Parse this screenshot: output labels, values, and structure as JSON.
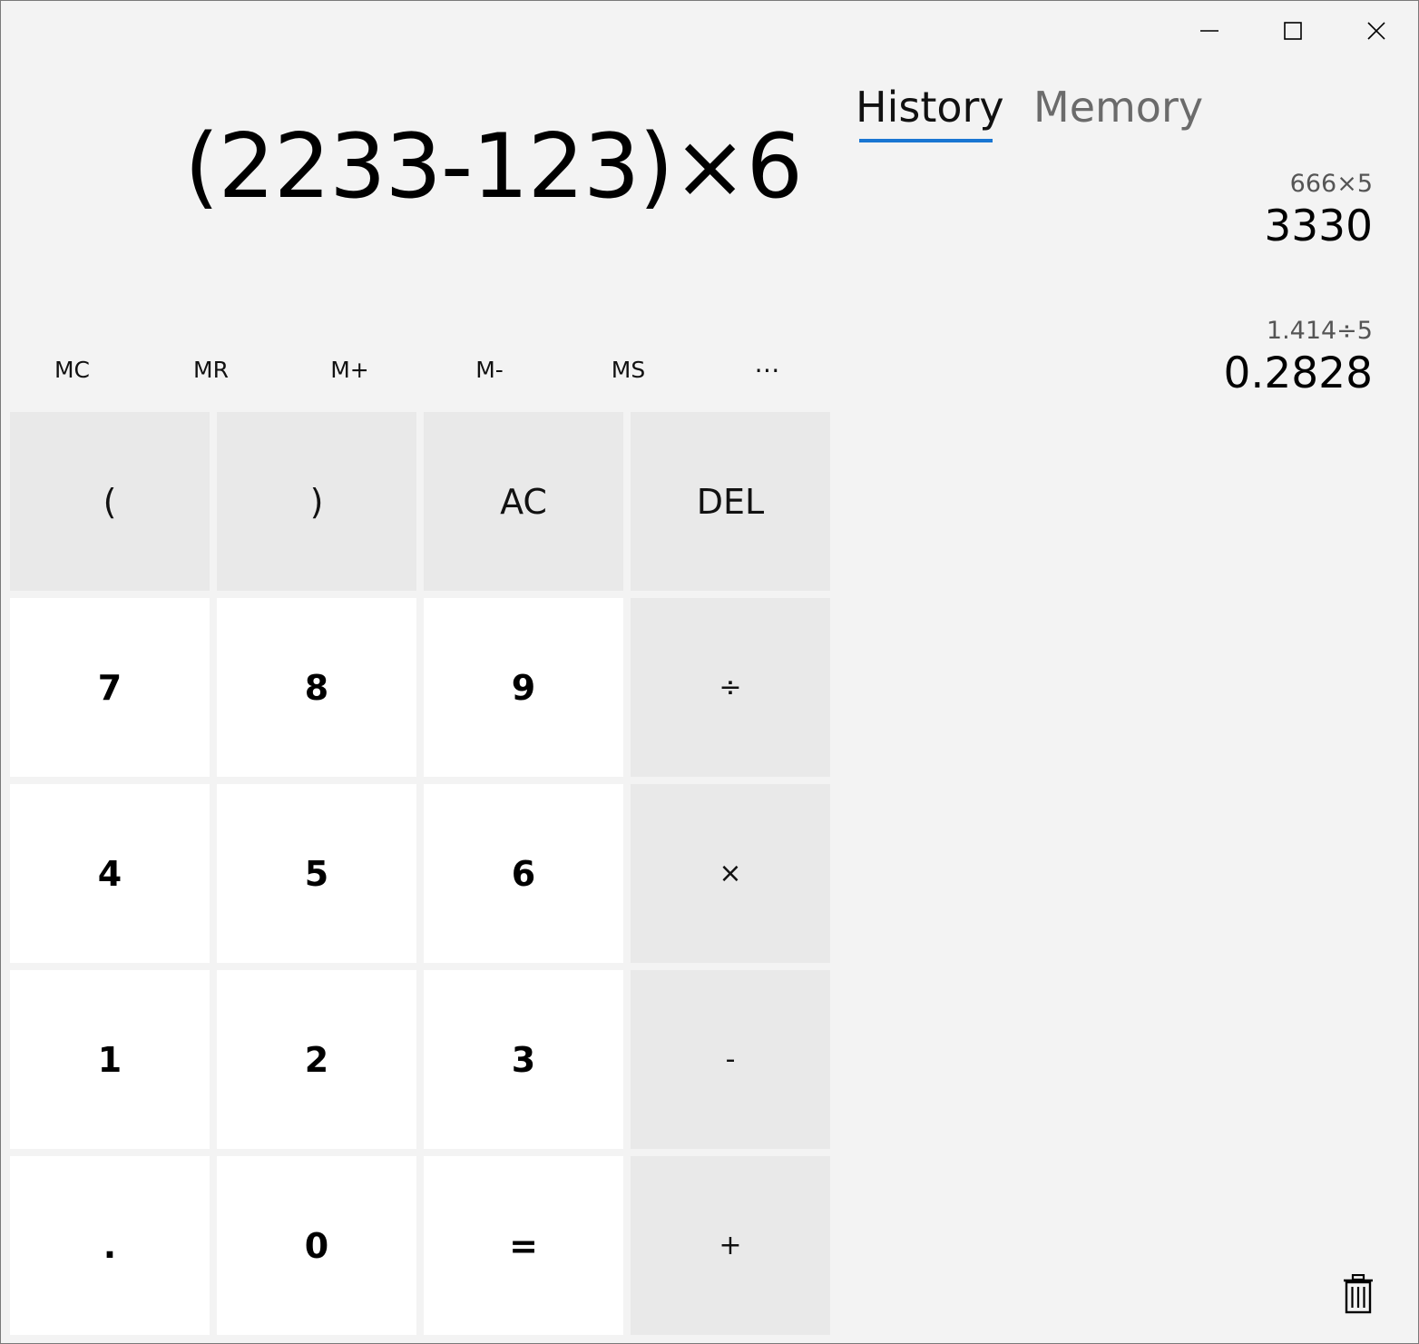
{
  "window": {
    "minimize_icon": "minimize-icon",
    "maximize_icon": "maximize-icon",
    "close_icon": "close-icon"
  },
  "display": {
    "expression": "(2233-123)×6"
  },
  "memory": {
    "buttons": [
      "MC",
      "MR",
      "M+",
      "M-",
      "MS",
      "⋯"
    ]
  },
  "keypad": {
    "rows": [
      [
        "(",
        ")",
        "AC",
        "DEL"
      ],
      [
        "7",
        "8",
        "9",
        "÷"
      ],
      [
        "4",
        "5",
        "6",
        "×"
      ],
      [
        "1",
        "2",
        "3",
        "-"
      ],
      [
        ".",
        "0",
        "=",
        "+"
      ]
    ]
  },
  "panel": {
    "tabs": [
      {
        "label": "History",
        "active": true
      },
      {
        "label": "Memory",
        "active": false
      }
    ],
    "history": [
      {
        "expression": "666×5",
        "result": "3330"
      },
      {
        "expression": "1.414÷5",
        "result": "0.2828"
      }
    ],
    "clear_icon": "trash-icon"
  },
  "colors": {
    "accent": "#1976d2",
    "background": "#f3f3f3",
    "key_light": "#ffffff",
    "key_grey": "#e9e9e9"
  }
}
